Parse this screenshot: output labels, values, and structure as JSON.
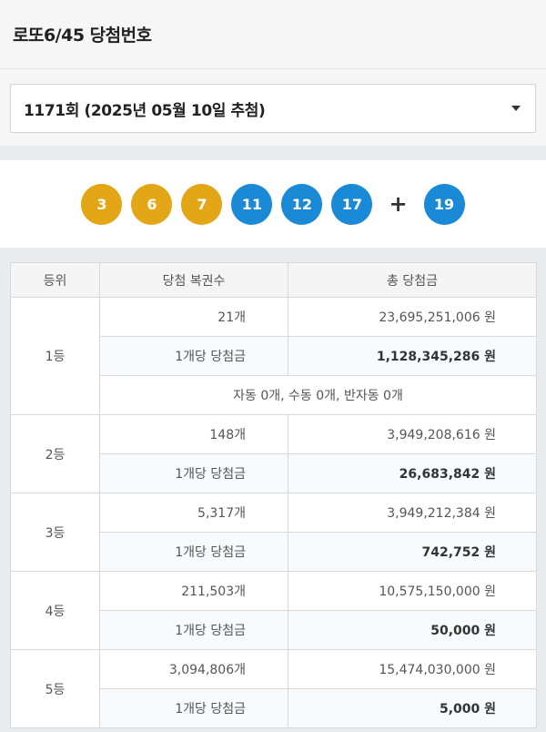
{
  "header": {
    "title": "로또6/45 당첨번호"
  },
  "draw_select": {
    "value": "1171회 (2025년 05월 10일 추첨)"
  },
  "balls": {
    "numbers": [
      {
        "n": "3",
        "color": "#e3a617"
      },
      {
        "n": "6",
        "color": "#e3a617"
      },
      {
        "n": "7",
        "color": "#e3a617"
      },
      {
        "n": "11",
        "color": "#1a8ad7"
      },
      {
        "n": "12",
        "color": "#1a8ad7"
      },
      {
        "n": "17",
        "color": "#1a8ad7"
      }
    ],
    "plus": "+",
    "bonus": {
      "n": "19",
      "color": "#1a8ad7"
    }
  },
  "table": {
    "headers": [
      "등위",
      "당첨 복권수",
      "총 당첨금"
    ],
    "per_label": "1개당 당첨금",
    "rows": [
      {
        "rank": "1등",
        "count": "21개",
        "total": "23,695,251,006 원",
        "per": "1,128,345,286 원",
        "extra": "자동 0개, 수동 0개, 반자동 0개"
      },
      {
        "rank": "2등",
        "count": "148개",
        "total": "3,949,208,616 원",
        "per": "26,683,842 원"
      },
      {
        "rank": "3등",
        "count": "5,317개",
        "total": "3,949,212,384 원",
        "per": "742,752 원"
      },
      {
        "rank": "4등",
        "count": "211,503개",
        "total": "10,575,150,000 원",
        "per": "50,000 원"
      },
      {
        "rank": "5등",
        "count": "3,094,806개",
        "total": "15,474,030,000 원",
        "per": "5,000 원"
      }
    ]
  }
}
